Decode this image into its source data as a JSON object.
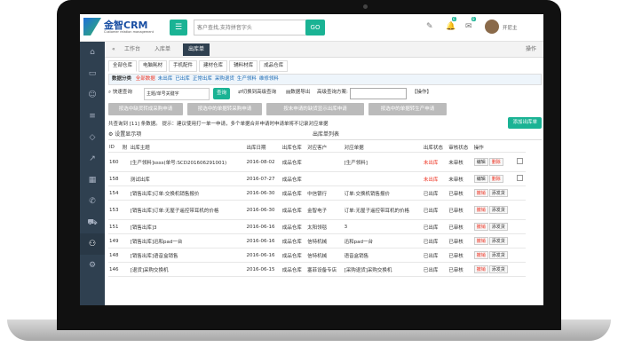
{
  "app": {
    "logo_title": "金智CRM",
    "logo_sub": "Customer relation management"
  },
  "search": {
    "placeholder": "客户查找,支持拼音字头",
    "go_label": "GO"
  },
  "header": {
    "badge1": "6",
    "badge2": "8",
    "user_name": "开尼主"
  },
  "tabs": [
    {
      "label": "工作台"
    },
    {
      "label": "入库单"
    },
    {
      "label": "出库单"
    }
  ],
  "tab_action": "操作",
  "warehouses": [
    "全部仓库",
    "电脑耗材",
    "手机配件",
    "建材仓库",
    "辅料材库",
    "成品仓库"
  ],
  "filter": {
    "label": "数据分类",
    "items": [
      {
        "label": "全部数据",
        "color": "red"
      },
      {
        "label": "未出库",
        "color": "blue"
      },
      {
        "label": "已出库",
        "color": "blue"
      },
      {
        "label": "正常出库",
        "color": "blue"
      },
      {
        "label": "采购退货",
        "color": "blue"
      },
      {
        "label": "生产领料",
        "color": "blue"
      },
      {
        "label": "维修领料",
        "color": "blue"
      }
    ]
  },
  "query": {
    "label": "快速查询",
    "value": "主题/单号关键字",
    "button": "查询",
    "switch_adv": "切换到高级查询",
    "export": "数据导出",
    "custom_query": "高级查询方案:",
    "action": "【操作】"
  },
  "action_buttons": [
    "按选中缺货转成采购申请",
    "按选中的单据转采购申请",
    "按未申请的缺货显示出库申请",
    "按选中的单据转生产申请"
  ],
  "info": {
    "text": "共查询到 [11] 条数据。 提示：建议使用打一单一申请，多个单据合并申请时申请单将不记录对应单据",
    "add_button": "添加出库单"
  },
  "table": {
    "settings": "设置显示项",
    "caption": "出库单列表",
    "headers": [
      "ID",
      "附",
      "出库主题",
      "出库日期",
      "出库仓库",
      "对应客户",
      "对应单据",
      "出库状态",
      "审核状态",
      "操作"
    ],
    "rows": [
      {
        "id": "160",
        "subject": "[生产领料]ssss(单号:SCD20160629​1001)",
        "date": "2016-08-02",
        "warehouse": "成品仓库",
        "customer": "",
        "doc": "[生产领料]",
        "status": "未出库",
        "audit": "未审核",
        "ops": [
          "编辑",
          "删除"
        ],
        "check": true
      },
      {
        "id": "158",
        "subject": "测试出库",
        "date": "2016-07-27",
        "warehouse": "成品仓库",
        "customer": "",
        "doc": "",
        "status": "未出库",
        "audit": "未审核",
        "ops": [
          "编辑",
          "删除"
        ],
        "check": true
      },
      {
        "id": "154",
        "subject": "[销售出库]订单:交换机销售报价",
        "date": "2016-06-30",
        "warehouse": "成品仓库",
        "customer": "中信银行",
        "doc": "订单:交换机销售报价",
        "status": "已出库",
        "audit": "已审核",
        "ops": [
          "撤销",
          "添发货"
        ],
        "check": false
      },
      {
        "id": "153",
        "subject": "[销售出库]订单:无屋子遥控带耳机的价格",
        "date": "2016-06-30",
        "warehouse": "成品仓库",
        "customer": "金智电子",
        "doc": "订单:无屋子遥控带耳机的价格",
        "status": "已出库",
        "audit": "已审核",
        "ops": [
          "撤销",
          "添发货"
        ],
        "check": false
      },
      {
        "id": "151",
        "subject": "[销售出库]3",
        "date": "2016-06-16",
        "warehouse": "成品仓库",
        "customer": "太阳领毯",
        "doc": "3",
        "status": "已出库",
        "audit": "已审核",
        "ops": [
          "撤销",
          "添发货"
        ],
        "check": false
      },
      {
        "id": "149",
        "subject": "[销售出库]迅和pad一台",
        "date": "2016-06-16",
        "warehouse": "成品仓库",
        "customer": "信特机械",
        "doc": "迅和pad一台",
        "status": "已出库",
        "audit": "已审核",
        "ops": [
          "撤销",
          "添发货"
        ],
        "check": false
      },
      {
        "id": "148",
        "subject": "[销售出库]语音盒销售",
        "date": "2016-06-16",
        "warehouse": "成品仓库",
        "customer": "信特机械",
        "doc": "语音盒销售",
        "status": "已出库",
        "audit": "已审核",
        "ops": [
          "撤销",
          "添发货"
        ],
        "check": false
      },
      {
        "id": "146",
        "subject": "[退货]采购交换机",
        "date": "2016-06-15",
        "warehouse": "成品仓库",
        "customer": "塞菲设备专店",
        "doc": "[采购退货]采购交换机",
        "status": "已出库",
        "audit": "已审核",
        "ops": [
          "撤销",
          "添发货"
        ],
        "check": false
      }
    ]
  }
}
